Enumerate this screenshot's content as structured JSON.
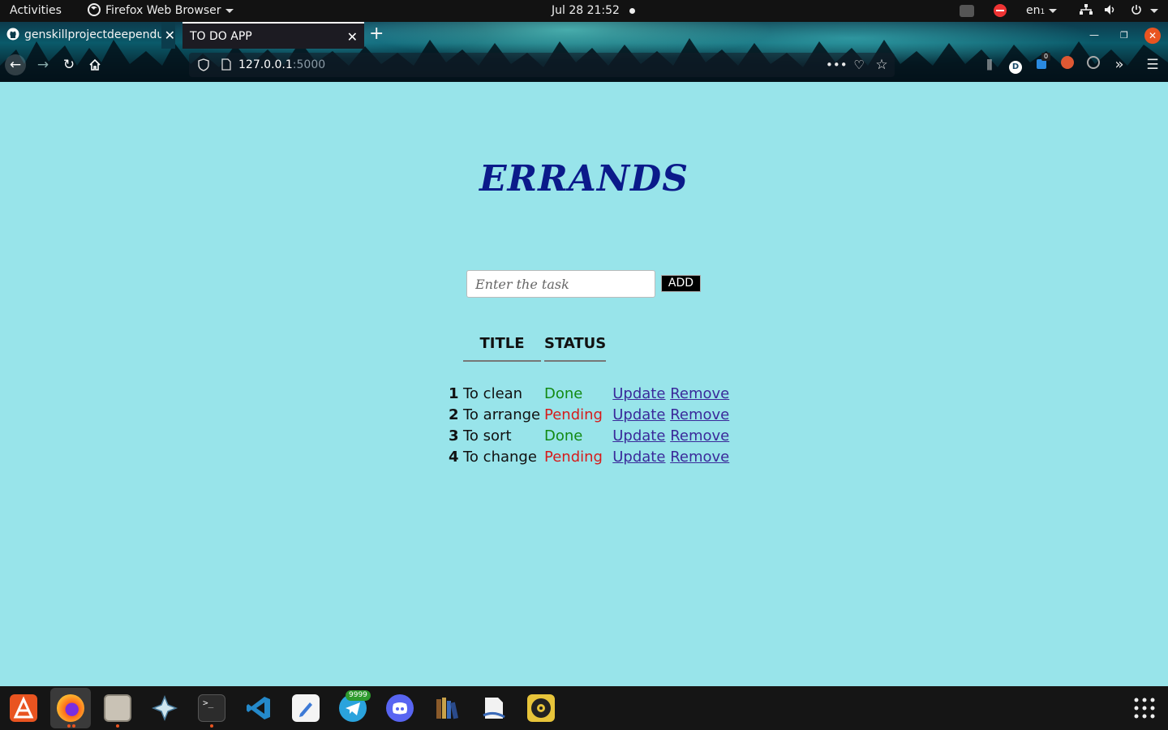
{
  "topbar": {
    "activities": "Activities",
    "app_name": "Firefox Web Browser",
    "datetime": "Jul 28  21:52",
    "lang": "en",
    "lang_suffix": "1"
  },
  "browser": {
    "tabs": [
      {
        "label": "genskillprojectdeependu"
      },
      {
        "label": "TO DO APP"
      }
    ],
    "url_host": "127.0.0.1",
    "url_port": ":5000",
    "badge_count": "0"
  },
  "page": {
    "title": "ERRANDS",
    "task_input_placeholder": "Enter the task",
    "add_label": "ADD",
    "columns": {
      "title": "TITLE",
      "status": "STATUS"
    },
    "tasks": [
      {
        "num": "1",
        "title": "To clean",
        "status": "Done",
        "update": "Update",
        "remove": "Remove"
      },
      {
        "num": "2",
        "title": "To arrange",
        "status": "Pending",
        "update": "Update",
        "remove": "Remove"
      },
      {
        "num": "3",
        "title": "To sort",
        "status": "Done",
        "update": "Update",
        "remove": "Remove"
      },
      {
        "num": "4",
        "title": "To change",
        "status": "Pending",
        "update": "Update",
        "remove": "Remove"
      }
    ]
  },
  "dock": {
    "telegram_badge": "9999",
    "apps": [
      "ubuntu-software-icon",
      "firefox-icon",
      "files-icon",
      "ppsspp-icon",
      "terminal-icon",
      "vscode-icon",
      "text-editor-icon",
      "telegram-icon",
      "discord-icon",
      "calibre-icon",
      "libreoffice-icon",
      "rhythmbox-icon",
      "app-grid-icon"
    ]
  },
  "colors": {
    "page_bg": "#98e4ea",
    "title": "#0b1a8a",
    "done": "#138a13",
    "pending": "#d61c1c",
    "link": "#3a2a9a"
  }
}
